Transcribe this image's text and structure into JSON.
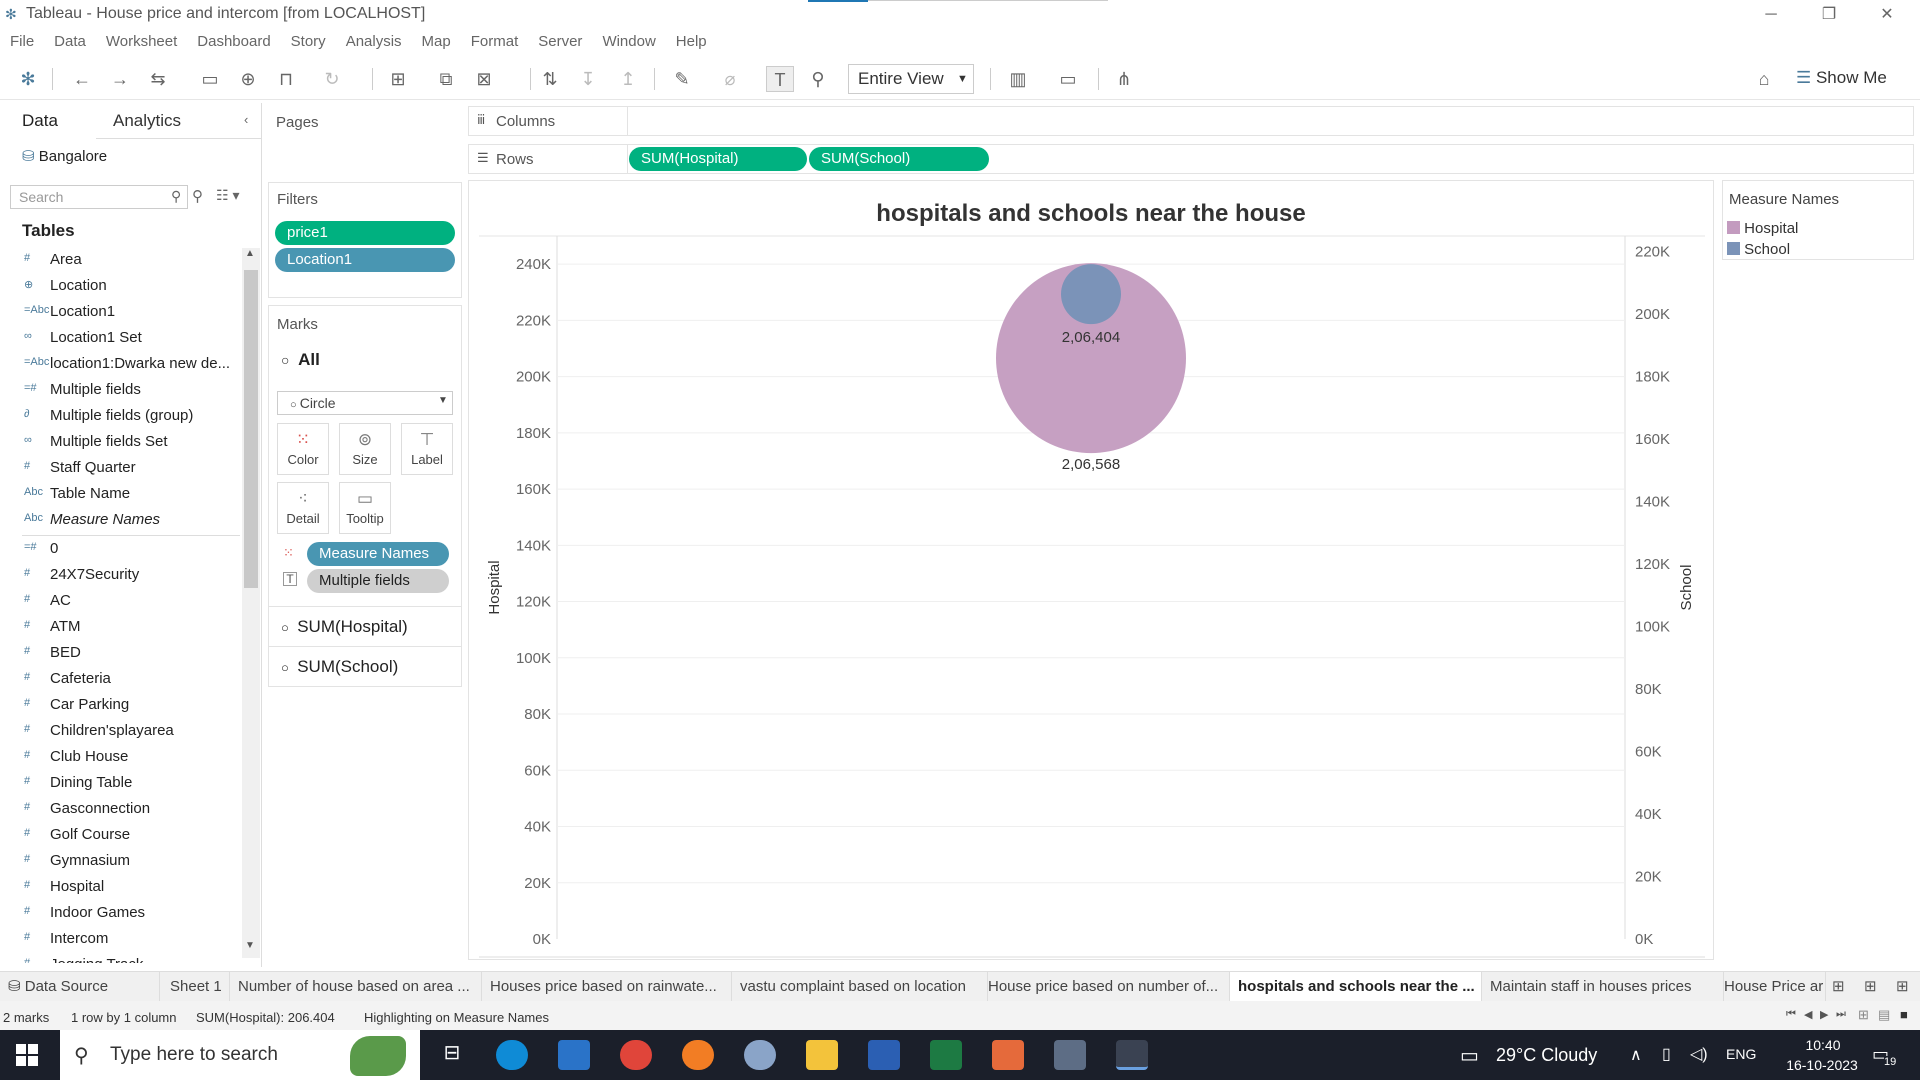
{
  "window": {
    "title": "Tableau - House price and intercom [from LOCALHOST]"
  },
  "menu": [
    "File",
    "Data",
    "Worksheet",
    "Dashboard",
    "Story",
    "Analysis",
    "Map",
    "Format",
    "Server",
    "Window",
    "Help"
  ],
  "toolbar": {
    "view_mode": "Entire View",
    "show_me": "Show Me"
  },
  "left_panel": {
    "tab_data": "Data",
    "tab_analytics": "Analytics",
    "datasource": "Bangalore",
    "search_placeholder": "Search",
    "tables_header": "Tables",
    "fields": [
      {
        "icon": "#",
        "name": "Area"
      },
      {
        "icon": "⊕",
        "name": "Location"
      },
      {
        "icon": "=Abc",
        "name": "Location1"
      },
      {
        "icon": "∞",
        "name": "Location1 Set"
      },
      {
        "icon": "=Abc",
        "name": "location1:Dwarka new de..."
      },
      {
        "icon": "=#",
        "name": "Multiple fields"
      },
      {
        "icon": "∂",
        "name": "Multiple fields (group)"
      },
      {
        "icon": "∞",
        "name": "Multiple fields Set"
      },
      {
        "icon": "#",
        "name": "Staff Quarter"
      },
      {
        "icon": "Abc",
        "name": "Table Name"
      },
      {
        "icon": "Abc",
        "name": "Measure Names"
      },
      {
        "icon": "=#",
        "name": "0"
      },
      {
        "icon": "#",
        "name": "24X7Security"
      },
      {
        "icon": "#",
        "name": "AC"
      },
      {
        "icon": "#",
        "name": "ATM"
      },
      {
        "icon": "#",
        "name": "BED"
      },
      {
        "icon": "#",
        "name": "Cafeteria"
      },
      {
        "icon": "#",
        "name": "Car Parking"
      },
      {
        "icon": "#",
        "name": "Children'splayarea"
      },
      {
        "icon": "#",
        "name": "Club House"
      },
      {
        "icon": "#",
        "name": "Dining Table"
      },
      {
        "icon": "#",
        "name": "Gasconnection"
      },
      {
        "icon": "#",
        "name": "Golf Course"
      },
      {
        "icon": "#",
        "name": "Gymnasium"
      },
      {
        "icon": "#",
        "name": "Hospital"
      },
      {
        "icon": "#",
        "name": "Indoor Games"
      },
      {
        "icon": "#",
        "name": "Intercom"
      },
      {
        "icon": "#",
        "name": "Jogging Track"
      }
    ]
  },
  "shelves": {
    "pages": "Pages",
    "filters": "Filters",
    "filter_pills": [
      "price1",
      "Location1"
    ],
    "marks": "Marks",
    "marks_all": "All",
    "mark_type": "Circle",
    "mark_buttons": [
      "Color",
      "Size",
      "Label",
      "Detail",
      "Tooltip"
    ],
    "mark_pills": [
      "Measure Names",
      "Multiple fields"
    ],
    "mark_cards": [
      "SUM(Hospital)",
      "SUM(School)"
    ],
    "columns": "Columns",
    "rows": "Rows",
    "row_pills": [
      "SUM(Hospital)",
      "SUM(School)"
    ]
  },
  "legend": {
    "title": "Measure Names",
    "items": [
      {
        "label": "Hospital",
        "color": "#c39bbf"
      },
      {
        "label": "School",
        "color": "#7b93b8"
      }
    ]
  },
  "chart_data": {
    "type": "scatter",
    "title": "hospitals and schools near the house",
    "left_axis": {
      "label": "Hospital",
      "range": [
        0,
        250000
      ],
      "ticks": [
        "0K",
        "20K",
        "40K",
        "60K",
        "80K",
        "100K",
        "120K",
        "140K",
        "160K",
        "180K",
        "200K",
        "220K",
        "240K"
      ]
    },
    "right_axis": {
      "label": "School",
      "range": [
        0,
        225000
      ],
      "ticks": [
        "0K",
        "20K",
        "40K",
        "60K",
        "80K",
        "100K",
        "120K",
        "140K",
        "160K",
        "180K",
        "200K",
        "220K"
      ]
    },
    "series": [
      {
        "name": "Hospital",
        "value": 206568,
        "label": "2,06,568",
        "color": "#c39bbf",
        "axis": "left",
        "size": "large"
      },
      {
        "name": "School",
        "value": 206404,
        "label": "2,06,404",
        "color": "#7b93b8",
        "axis": "right",
        "size": "small"
      }
    ]
  },
  "sheet_tabs": [
    "Data Source",
    "Sheet 1",
    "Number of house based on area ...",
    "Houses price based on rainwate...",
    "vastu complaint based on location",
    "House price based on number of...",
    "hospitals and schools near the ...",
    "Maintain staff in houses prices",
    "House Price ar"
  ],
  "active_sheet": "hospitals and schools near the ...",
  "status": {
    "marks": "2 marks",
    "layout": "1 row by 1 column",
    "sum": "SUM(Hospital): 206.404",
    "highlight": "Highlighting on Measure Names"
  },
  "taskbar": {
    "search": "Type here to search",
    "weather": "29°C  Cloudy",
    "lang": "ENG",
    "time": "10:40",
    "date": "16-10-2023",
    "notif": "19"
  }
}
